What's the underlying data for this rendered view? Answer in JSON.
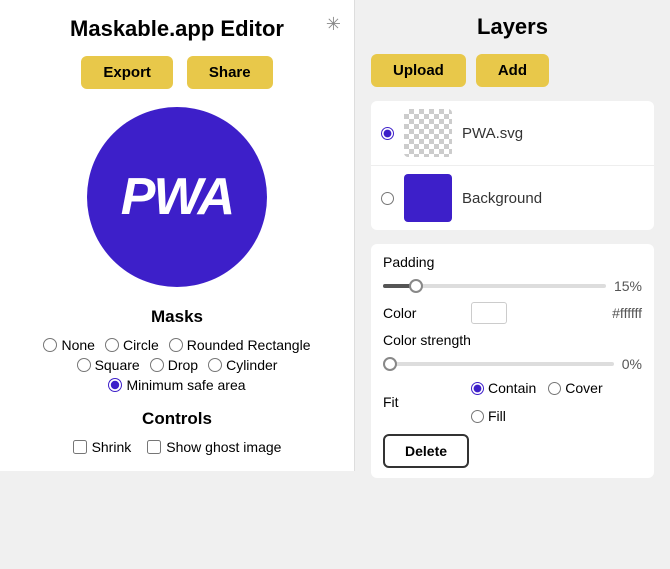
{
  "leftPanel": {
    "title": "Maskable.app Editor",
    "exportLabel": "Export",
    "shareLabel": "Share",
    "masks": {
      "title": "Masks",
      "options": [
        {
          "label": "None",
          "value": "none",
          "checked": false
        },
        {
          "label": "Circle",
          "value": "circle",
          "checked": false
        },
        {
          "label": "Rounded Rectangle",
          "value": "rounded-rectangle",
          "checked": false
        },
        {
          "label": "Square",
          "value": "square",
          "checked": false
        },
        {
          "label": "Drop",
          "value": "drop",
          "checked": false
        },
        {
          "label": "Cylinder",
          "value": "cylinder",
          "checked": false
        },
        {
          "label": "Minimum safe area",
          "value": "minimum-safe-area",
          "checked": true
        }
      ]
    },
    "controls": {
      "title": "Controls",
      "shrinkLabel": "Shrink",
      "ghostLabel": "Show ghost image"
    }
  },
  "rightPanel": {
    "title": "Layers",
    "uploadLabel": "Upload",
    "addLabel": "Add",
    "layers": [
      {
        "name": "PWA.svg",
        "type": "svg",
        "selected": true
      },
      {
        "name": "Background",
        "type": "background",
        "selected": false
      }
    ],
    "properties": {
      "padding": {
        "label": "Padding",
        "value": "15%",
        "fillPercent": 15
      },
      "color": {
        "label": "Color",
        "value": "#ffffff"
      },
      "colorStrength": {
        "label": "Color strength",
        "value": "0%",
        "fillPercent": 0
      },
      "fit": {
        "label": "Fit",
        "options": [
          {
            "label": "Contain",
            "value": "contain",
            "checked": true
          },
          {
            "label": "Cover",
            "value": "cover",
            "checked": false
          },
          {
            "label": "Fill",
            "value": "fill",
            "checked": false
          }
        ]
      },
      "deleteLabel": "Delete"
    }
  }
}
